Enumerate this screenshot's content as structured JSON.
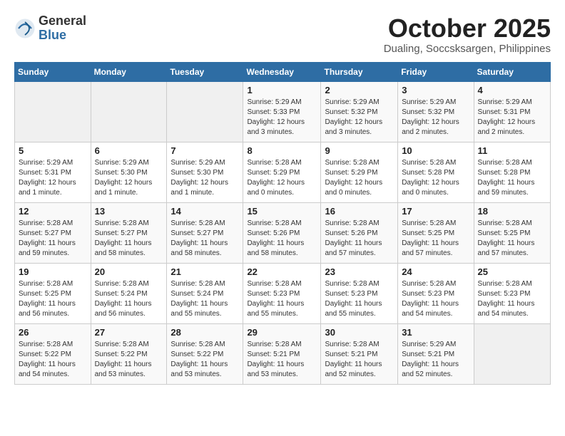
{
  "header": {
    "logo_general": "General",
    "logo_blue": "Blue",
    "month_title": "October 2025",
    "location": "Dualing, Soccsksargen, Philippines"
  },
  "calendar": {
    "days_of_week": [
      "Sunday",
      "Monday",
      "Tuesday",
      "Wednesday",
      "Thursday",
      "Friday",
      "Saturday"
    ],
    "weeks": [
      [
        {
          "num": "",
          "sunrise": "",
          "sunset": "",
          "daylight": "",
          "empty": true
        },
        {
          "num": "",
          "sunrise": "",
          "sunset": "",
          "daylight": "",
          "empty": true
        },
        {
          "num": "",
          "sunrise": "",
          "sunset": "",
          "daylight": "",
          "empty": true
        },
        {
          "num": "1",
          "sunrise": "Sunrise: 5:29 AM",
          "sunset": "Sunset: 5:33 PM",
          "daylight": "Daylight: 12 hours and 3 minutes.",
          "empty": false
        },
        {
          "num": "2",
          "sunrise": "Sunrise: 5:29 AM",
          "sunset": "Sunset: 5:32 PM",
          "daylight": "Daylight: 12 hours and 3 minutes.",
          "empty": false
        },
        {
          "num": "3",
          "sunrise": "Sunrise: 5:29 AM",
          "sunset": "Sunset: 5:32 PM",
          "daylight": "Daylight: 12 hours and 2 minutes.",
          "empty": false
        },
        {
          "num": "4",
          "sunrise": "Sunrise: 5:29 AM",
          "sunset": "Sunset: 5:31 PM",
          "daylight": "Daylight: 12 hours and 2 minutes.",
          "empty": false
        }
      ],
      [
        {
          "num": "5",
          "sunrise": "Sunrise: 5:29 AM",
          "sunset": "Sunset: 5:31 PM",
          "daylight": "Daylight: 12 hours and 1 minute.",
          "empty": false
        },
        {
          "num": "6",
          "sunrise": "Sunrise: 5:29 AM",
          "sunset": "Sunset: 5:30 PM",
          "daylight": "Daylight: 12 hours and 1 minute.",
          "empty": false
        },
        {
          "num": "7",
          "sunrise": "Sunrise: 5:29 AM",
          "sunset": "Sunset: 5:30 PM",
          "daylight": "Daylight: 12 hours and 1 minute.",
          "empty": false
        },
        {
          "num": "8",
          "sunrise": "Sunrise: 5:28 AM",
          "sunset": "Sunset: 5:29 PM",
          "daylight": "Daylight: 12 hours and 0 minutes.",
          "empty": false
        },
        {
          "num": "9",
          "sunrise": "Sunrise: 5:28 AM",
          "sunset": "Sunset: 5:29 PM",
          "daylight": "Daylight: 12 hours and 0 minutes.",
          "empty": false
        },
        {
          "num": "10",
          "sunrise": "Sunrise: 5:28 AM",
          "sunset": "Sunset: 5:28 PM",
          "daylight": "Daylight: 12 hours and 0 minutes.",
          "empty": false
        },
        {
          "num": "11",
          "sunrise": "Sunrise: 5:28 AM",
          "sunset": "Sunset: 5:28 PM",
          "daylight": "Daylight: 11 hours and 59 minutes.",
          "empty": false
        }
      ],
      [
        {
          "num": "12",
          "sunrise": "Sunrise: 5:28 AM",
          "sunset": "Sunset: 5:27 PM",
          "daylight": "Daylight: 11 hours and 59 minutes.",
          "empty": false
        },
        {
          "num": "13",
          "sunrise": "Sunrise: 5:28 AM",
          "sunset": "Sunset: 5:27 PM",
          "daylight": "Daylight: 11 hours and 58 minutes.",
          "empty": false
        },
        {
          "num": "14",
          "sunrise": "Sunrise: 5:28 AM",
          "sunset": "Sunset: 5:27 PM",
          "daylight": "Daylight: 11 hours and 58 minutes.",
          "empty": false
        },
        {
          "num": "15",
          "sunrise": "Sunrise: 5:28 AM",
          "sunset": "Sunset: 5:26 PM",
          "daylight": "Daylight: 11 hours and 58 minutes.",
          "empty": false
        },
        {
          "num": "16",
          "sunrise": "Sunrise: 5:28 AM",
          "sunset": "Sunset: 5:26 PM",
          "daylight": "Daylight: 11 hours and 57 minutes.",
          "empty": false
        },
        {
          "num": "17",
          "sunrise": "Sunrise: 5:28 AM",
          "sunset": "Sunset: 5:25 PM",
          "daylight": "Daylight: 11 hours and 57 minutes.",
          "empty": false
        },
        {
          "num": "18",
          "sunrise": "Sunrise: 5:28 AM",
          "sunset": "Sunset: 5:25 PM",
          "daylight": "Daylight: 11 hours and 57 minutes.",
          "empty": false
        }
      ],
      [
        {
          "num": "19",
          "sunrise": "Sunrise: 5:28 AM",
          "sunset": "Sunset: 5:25 PM",
          "daylight": "Daylight: 11 hours and 56 minutes.",
          "empty": false
        },
        {
          "num": "20",
          "sunrise": "Sunrise: 5:28 AM",
          "sunset": "Sunset: 5:24 PM",
          "daylight": "Daylight: 11 hours and 56 minutes.",
          "empty": false
        },
        {
          "num": "21",
          "sunrise": "Sunrise: 5:28 AM",
          "sunset": "Sunset: 5:24 PM",
          "daylight": "Daylight: 11 hours and 55 minutes.",
          "empty": false
        },
        {
          "num": "22",
          "sunrise": "Sunrise: 5:28 AM",
          "sunset": "Sunset: 5:23 PM",
          "daylight": "Daylight: 11 hours and 55 minutes.",
          "empty": false
        },
        {
          "num": "23",
          "sunrise": "Sunrise: 5:28 AM",
          "sunset": "Sunset: 5:23 PM",
          "daylight": "Daylight: 11 hours and 55 minutes.",
          "empty": false
        },
        {
          "num": "24",
          "sunrise": "Sunrise: 5:28 AM",
          "sunset": "Sunset: 5:23 PM",
          "daylight": "Daylight: 11 hours and 54 minutes.",
          "empty": false
        },
        {
          "num": "25",
          "sunrise": "Sunrise: 5:28 AM",
          "sunset": "Sunset: 5:23 PM",
          "daylight": "Daylight: 11 hours and 54 minutes.",
          "empty": false
        }
      ],
      [
        {
          "num": "26",
          "sunrise": "Sunrise: 5:28 AM",
          "sunset": "Sunset: 5:22 PM",
          "daylight": "Daylight: 11 hours and 54 minutes.",
          "empty": false
        },
        {
          "num": "27",
          "sunrise": "Sunrise: 5:28 AM",
          "sunset": "Sunset: 5:22 PM",
          "daylight": "Daylight: 11 hours and 53 minutes.",
          "empty": false
        },
        {
          "num": "28",
          "sunrise": "Sunrise: 5:28 AM",
          "sunset": "Sunset: 5:22 PM",
          "daylight": "Daylight: 11 hours and 53 minutes.",
          "empty": false
        },
        {
          "num": "29",
          "sunrise": "Sunrise: 5:28 AM",
          "sunset": "Sunset: 5:21 PM",
          "daylight": "Daylight: 11 hours and 53 minutes.",
          "empty": false
        },
        {
          "num": "30",
          "sunrise": "Sunrise: 5:28 AM",
          "sunset": "Sunset: 5:21 PM",
          "daylight": "Daylight: 11 hours and 52 minutes.",
          "empty": false
        },
        {
          "num": "31",
          "sunrise": "Sunrise: 5:29 AM",
          "sunset": "Sunset: 5:21 PM",
          "daylight": "Daylight: 11 hours and 52 minutes.",
          "empty": false
        },
        {
          "num": "",
          "sunrise": "",
          "sunset": "",
          "daylight": "",
          "empty": true
        }
      ]
    ]
  }
}
